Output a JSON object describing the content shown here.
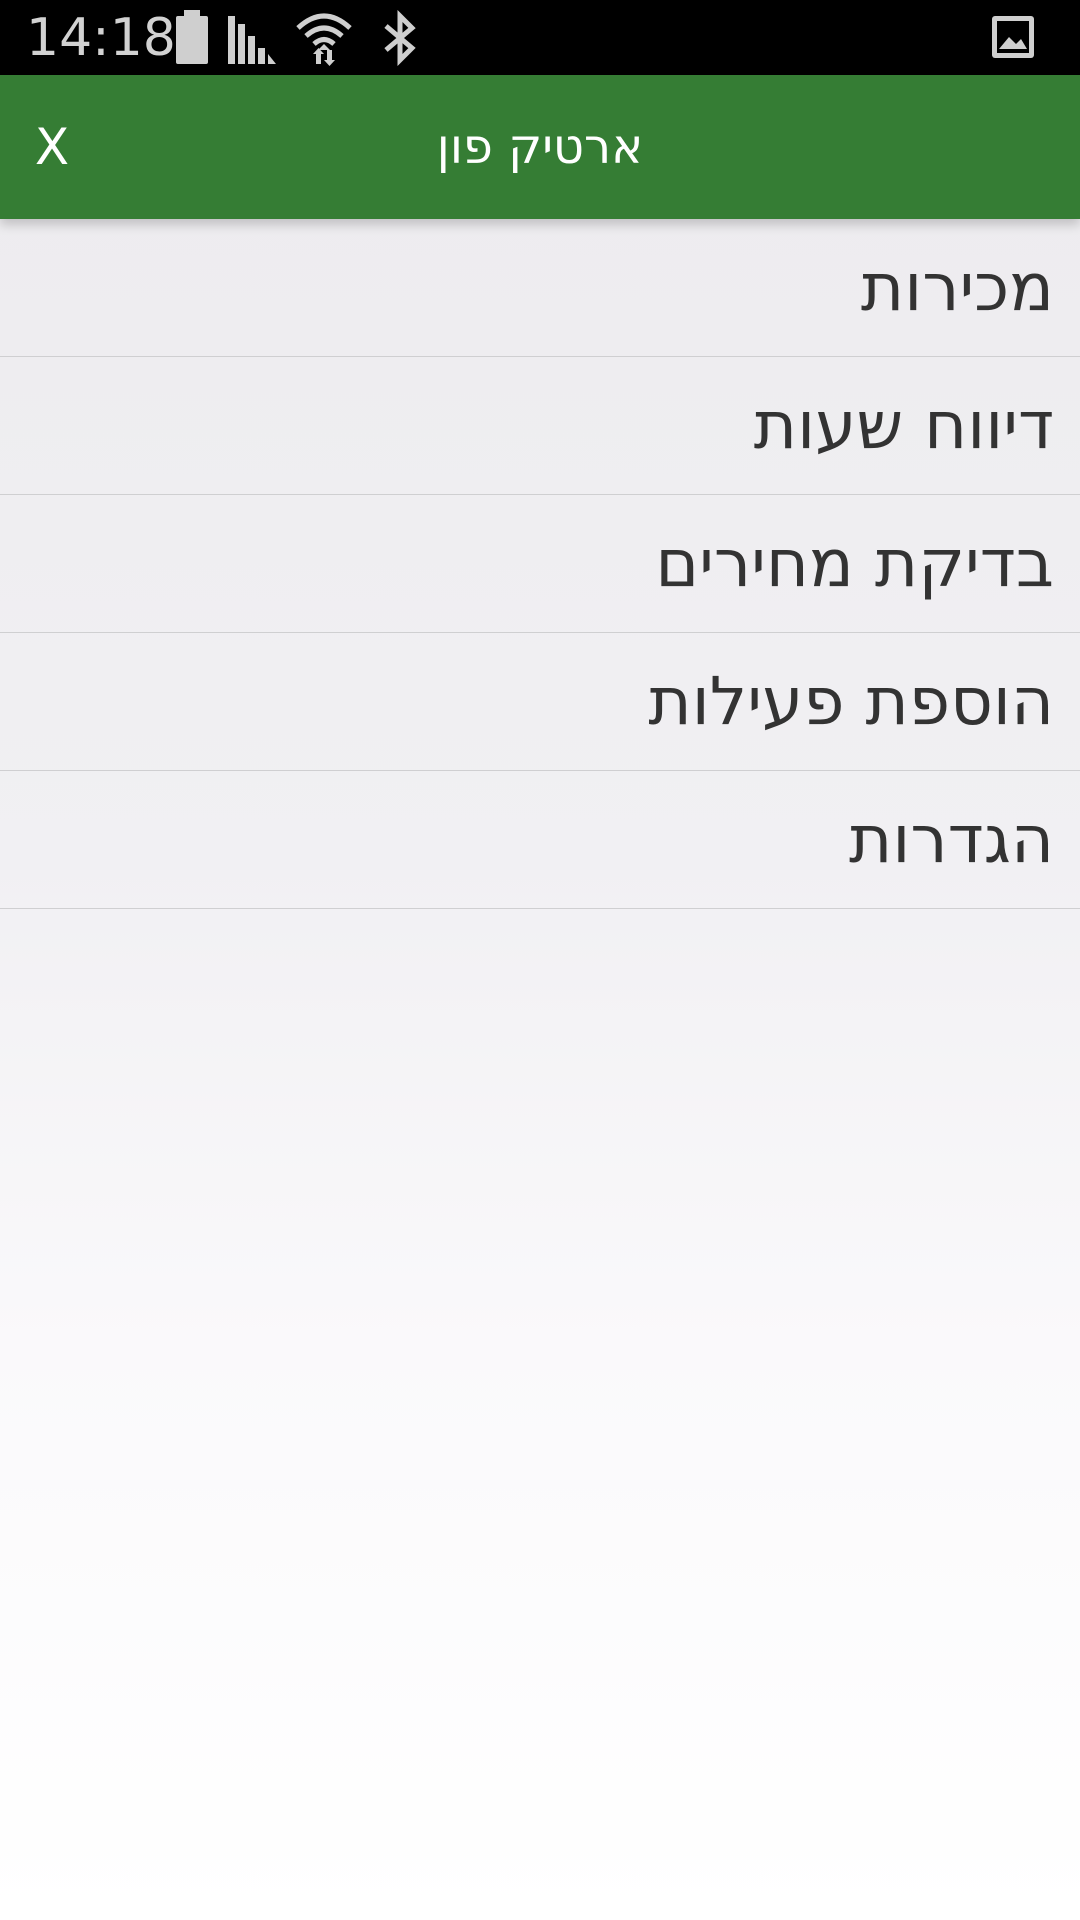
{
  "status_bar": {
    "time": "14:18",
    "icons": [
      "battery-icon",
      "signal-icon",
      "wifi-icon",
      "bluetooth-icon",
      "image-notify-icon"
    ],
    "background": "#000000"
  },
  "app_bar": {
    "title": "ארטיק פון",
    "close_label": "X",
    "color": "#357d34"
  },
  "menu": {
    "items": [
      {
        "label": "מכירות"
      },
      {
        "label": "דיווח שעות"
      },
      {
        "label": "בדיקת מחירים"
      },
      {
        "label": "הוספת פעילות"
      },
      {
        "label": "הגדרות"
      }
    ]
  }
}
